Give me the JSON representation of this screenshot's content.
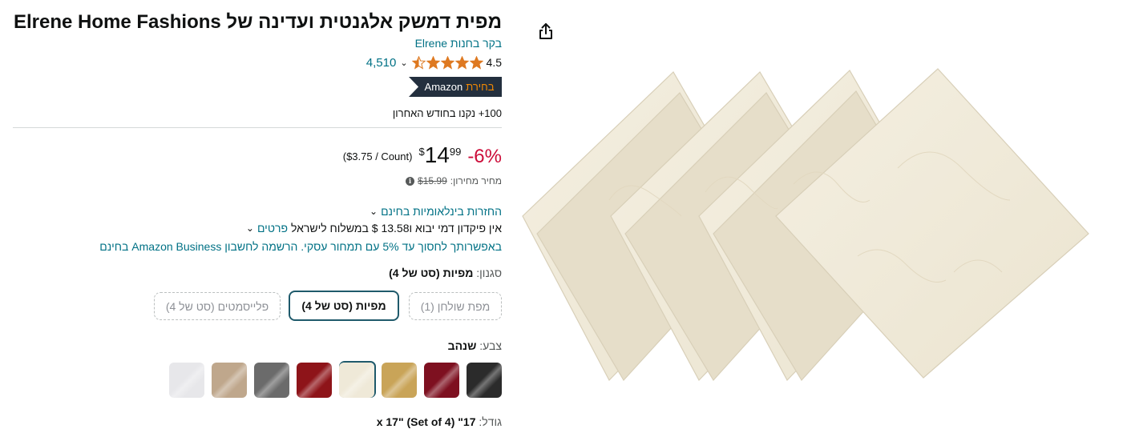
{
  "product": {
    "title": "מפית דמשק אלגנטית ועדינה של Elrene Home Fashions",
    "store_link": "בקר בחנות Elrene",
    "rating": "4.5",
    "rating_count": "4,510",
    "stars_filled": 4.5,
    "choice_badge": {
      "prefix": "Amazon",
      "choice": "בחירת"
    },
    "bought_recently": "100+ נקנו בחודש האחרון"
  },
  "pricing": {
    "discount": "-6%",
    "currency_symbol": "$",
    "whole": "14",
    "fraction": "99",
    "unit_price": "($3.75 / Count)",
    "list_price_label": "מחיר מחירון:",
    "list_price": "$15.99"
  },
  "shipping": {
    "returns": "החזרות בינלאומיות בחינם",
    "import_text": "אין פיקדון דמי יבוא ו‎$ 13.58 במשלוח לישראל",
    "import_link": "פרטים",
    "business": "באפשרותך לחסוך עד 5% עם תמחור עסקי. הרשמה לחשבון Amazon Business בחינם"
  },
  "style": {
    "label": "סגנון:",
    "selected": "מפיות (סט של 4)",
    "options": [
      "מפת שולחן (1)",
      "מפיות (סט של 4)",
      "פלייסמטים (סט של 4)"
    ]
  },
  "color": {
    "label": "צבע:",
    "selected": "שנהב",
    "swatch_colors": [
      "#2b2b2b",
      "#7e1020",
      "#c9a458",
      "#efe9d8",
      "#8e1419",
      "#6b6b6b",
      "#bfa78c",
      "#e7e7ea"
    ]
  },
  "size": {
    "label": "גודל:",
    "selected": "17\" x 17\" (Set of 4)"
  },
  "colors": {
    "link": "#007185",
    "price_discount": "#cc0c39",
    "star": "#de7921",
    "badge_bg": "#232f3e",
    "badge_accent": "#f08804"
  }
}
